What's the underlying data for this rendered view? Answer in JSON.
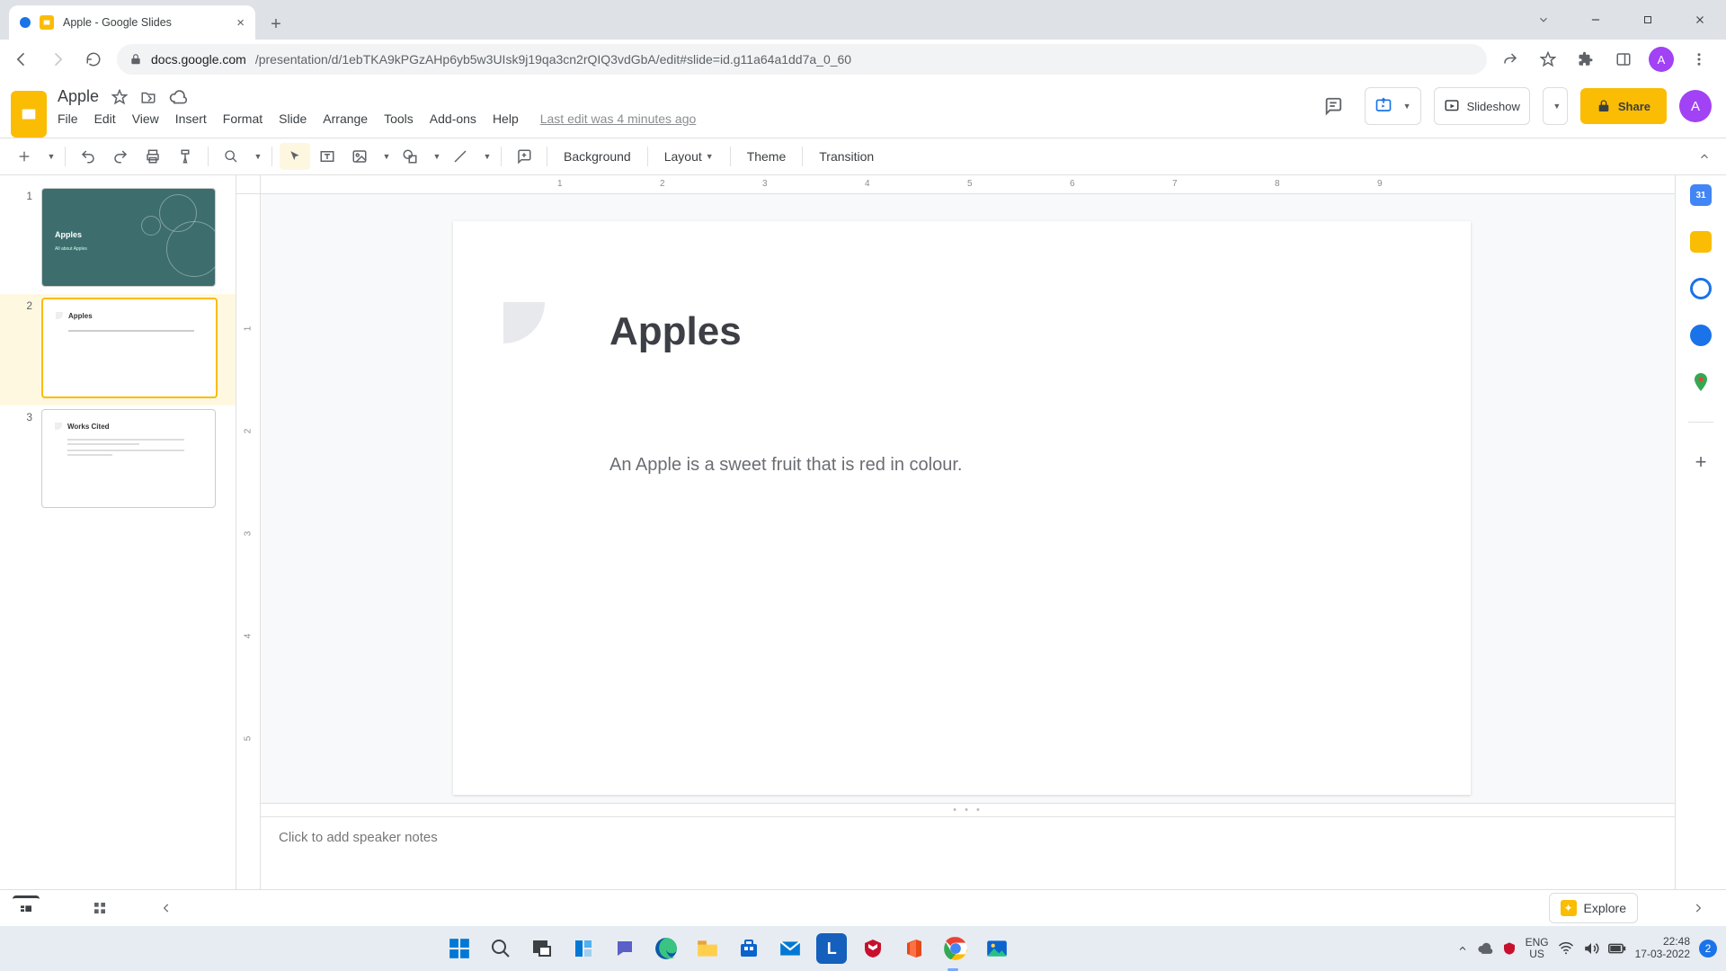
{
  "browser": {
    "tab_title": "Apple - Google Slides",
    "url_host": "docs.google.com",
    "url_path": "/presentation/d/1ebTKA9kPGzAHp6yb5w3UIsk9j19qa3cn2rQIQ3vdGbA/edit#slide=id.g11a64a1dd7a_0_60"
  },
  "app": {
    "doc_title": "Apple",
    "menus": [
      "File",
      "Edit",
      "View",
      "Insert",
      "Format",
      "Slide",
      "Arrange",
      "Tools",
      "Add-ons",
      "Help"
    ],
    "last_edit": "Last edit was 4 minutes ago",
    "slideshow_label": "Slideshow",
    "share_label": "Share",
    "account_initial": "A"
  },
  "toolbar": {
    "background": "Background",
    "layout": "Layout",
    "theme": "Theme",
    "transition": "Transition"
  },
  "filmstrip": {
    "thumbs": [
      {
        "num": "1",
        "title": "Apples",
        "sub": "All about Apples"
      },
      {
        "num": "2",
        "title": "Apples"
      },
      {
        "num": "3",
        "title": "Works Cited"
      }
    ]
  },
  "slide": {
    "title": "Apples",
    "body": "An Apple is a sweet fruit that is red in colour."
  },
  "notes": {
    "placeholder": "Click to add speaker notes"
  },
  "explore": {
    "label": "Explore"
  },
  "ruler": {
    "h": [
      "1",
      "2",
      "3",
      "4",
      "5",
      "6",
      "7",
      "8",
      "9"
    ],
    "v": [
      "1",
      "2",
      "3",
      "4",
      "5"
    ]
  },
  "taskbar": {
    "lang1": "ENG",
    "lang2": "US",
    "time": "22:48",
    "date": "17-03-2022"
  }
}
